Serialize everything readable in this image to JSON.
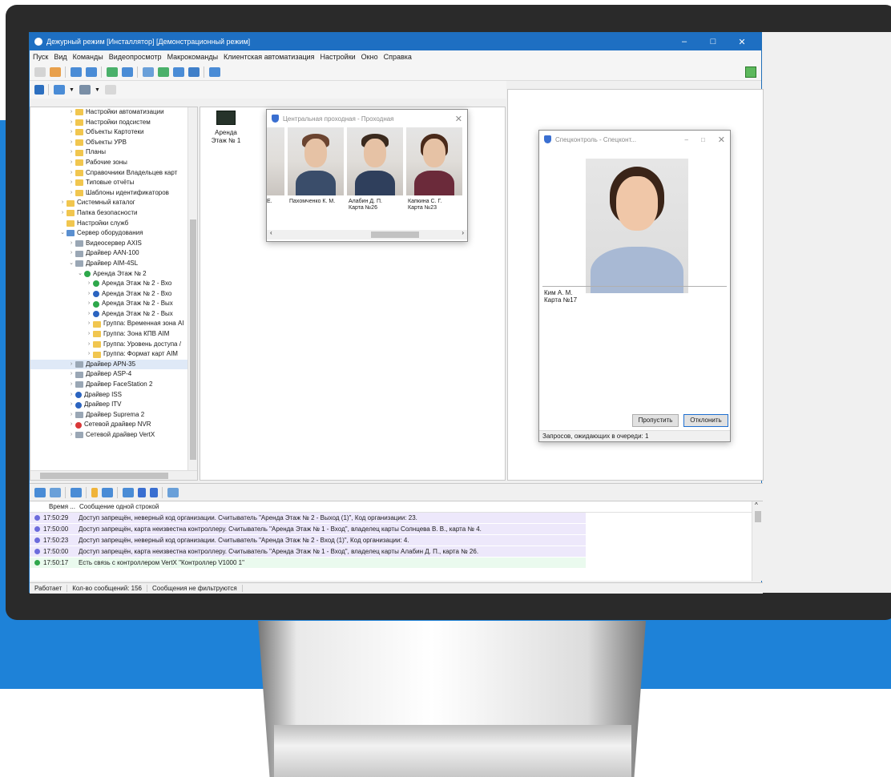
{
  "app": {
    "title": "Дежурный режим [Инсталлятор] [Демонстрационный режим]",
    "menu": [
      "Пуск",
      "Вид",
      "Команды",
      "Видеопросмотр",
      "Макрокоманды",
      "Клиентская автоматизация",
      "Настройки",
      "Окно",
      "Справка"
    ]
  },
  "tree": {
    "items": [
      {
        "label": "Настройки автоматизации",
        "icon": "folder-icon"
      },
      {
        "label": "Настройки подсистем",
        "icon": "folder-icon"
      },
      {
        "label": "Объекты Картотеки",
        "icon": "folder-icon"
      },
      {
        "label": "Объекты УРВ",
        "icon": "folder-icon"
      },
      {
        "label": "Планы",
        "icon": "folder-icon"
      },
      {
        "label": "Рабочие зоны",
        "icon": "folder-icon"
      },
      {
        "label": "Справочники Владельцев карт",
        "icon": "folder-icon"
      },
      {
        "label": "Типовые отчёты",
        "icon": "folder-icon"
      },
      {
        "label": "Шаблоны идентификаторов",
        "icon": "folder-icon"
      },
      {
        "label": "Системный каталог",
        "icon": "folder-icon"
      },
      {
        "label": "Папка безопасности",
        "icon": "folder-icon"
      },
      {
        "label": "Настройки служб",
        "icon": "folder-icon"
      },
      {
        "label": "Сервер оборудования",
        "icon": "server-icon"
      },
      {
        "label": "Видеосервер AXIS",
        "icon": "driver-icon"
      },
      {
        "label": "Драйвер AAN-100",
        "icon": "driver-icon"
      },
      {
        "label": "Драйвер AIM-4SL",
        "icon": "driver-icon"
      },
      {
        "label": "Аренда Этаж № 2",
        "icon": "status-ok-icon"
      },
      {
        "label": "Аренда Этаж № 2 - Вхо",
        "icon": "status-ok-icon"
      },
      {
        "label": "Аренда Этаж № 2 - Вхо",
        "icon": "status-unknown-icon"
      },
      {
        "label": "Аренда Этаж № 2 - Вых",
        "icon": "status-ok-icon"
      },
      {
        "label": "Аренда Этаж № 2 - Вых",
        "icon": "status-unknown-icon"
      },
      {
        "label": "Группа: Временная зона AI",
        "icon": "folder-icon"
      },
      {
        "label": "Группа: Зона КПВ AIM",
        "icon": "folder-icon"
      },
      {
        "label": "Группа: Уровень доступа /",
        "icon": "folder-icon"
      },
      {
        "label": "Группа: Формат карт AIM",
        "icon": "folder-icon"
      },
      {
        "label": "Драйвер APN-35",
        "icon": "driver-icon"
      },
      {
        "label": "Драйвер ASP-4",
        "icon": "driver-icon"
      },
      {
        "label": "Драйвер FaceStation 2",
        "icon": "driver-icon"
      },
      {
        "label": "Драйвер ISS",
        "icon": "status-unknown-icon"
      },
      {
        "label": "Драйвер ITV",
        "icon": "status-unknown-icon"
      },
      {
        "label": "Драйвер Suprema 2",
        "icon": "driver-icon"
      },
      {
        "label": "Сетевой драйвер NVR",
        "icon": "status-error-icon"
      },
      {
        "label": "Сетевой драйвер VertX",
        "icon": "driver-icon"
      }
    ]
  },
  "middle": {
    "camera_label": "Аренда Этаж № 1"
  },
  "entry_window": {
    "title": "Центральная проходная - Проходная",
    "cards": [
      {
        "name": "Е.",
        "card": ""
      },
      {
        "name": "Пахомченко К. М.",
        "card": ""
      },
      {
        "name": "Алабин Д. П.",
        "card": "Карта №26"
      },
      {
        "name": "Капкина С. Г.",
        "card": "Карта №23"
      }
    ]
  },
  "control_window": {
    "title": "Спецконтроль - Спецконт...",
    "person_name": "Ким А. М.",
    "person_card": "Карта №17",
    "skip_label": "Пропустить",
    "reject_label": "Отклонить",
    "queue_text": "Запросов, ожидающих в очереди: 1"
  },
  "log": {
    "col_time": "Время ...",
    "col_message": "Сообщение одной строкой",
    "rows": [
      {
        "time": "17:50:29",
        "msg": "Доступ запрещён, неверный код организации. Считыватель \"Аренда Этаж № 2 - Выход (1)\", Код организации: 23.",
        "type": "denied",
        "color": "#6c6bdc"
      },
      {
        "time": "17:50:00",
        "msg": "Доступ запрещён, карта неизвестна контроллеру. Считыватель \"Аренда Этаж № 1 - Вход\", владелец карты Солнцева В. В., карта № 4.",
        "type": "denied",
        "color": "#6c6bdc"
      },
      {
        "time": "17:50:23",
        "msg": "Доступ запрещён, неверный код организации. Считыватель \"Аренда Этаж № 2 - Вход (1)\", Код организации: 4.",
        "type": "denied",
        "color": "#6c6bdc"
      },
      {
        "time": "17:50:00",
        "msg": "Доступ запрещён, карта неизвестна контроллеру. Считыватель \"Аренда Этаж № 1 - Вход\", владелец карты Алабин Д. П., карта № 26.",
        "type": "denied",
        "color": "#6c6bdc"
      },
      {
        "time": "17:50:17",
        "msg": "Есть связь с контроллером VertX \"Контроллер V1000 1\"",
        "type": "ok",
        "color": "#2ea84b"
      }
    ]
  },
  "status": {
    "state": "Работает",
    "count": "Кол-во сообщений: 156",
    "filter": "Сообщения не фильтруются"
  }
}
